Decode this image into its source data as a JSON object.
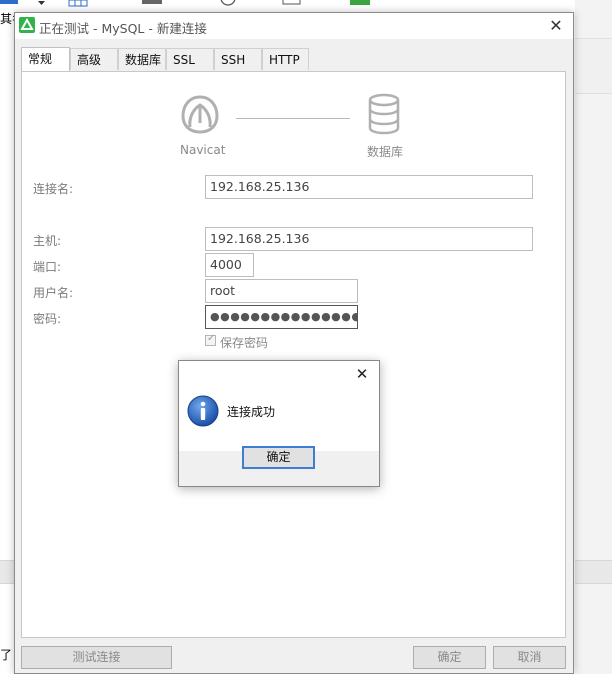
{
  "background": {
    "left_top_text": "其名",
    "left_bottom_text": "了"
  },
  "window": {
    "title": "正在测试 - MySQL - 新建连接",
    "close_glyph": "✕"
  },
  "tabs": [
    {
      "label": "常规",
      "active": true
    },
    {
      "label": "高级"
    },
    {
      "label": "数据库"
    },
    {
      "label": "SSL"
    },
    {
      "label": "SSH"
    },
    {
      "label": "HTTP"
    }
  ],
  "diagram": {
    "left_label": "Navicat",
    "right_label": "数据库"
  },
  "form": {
    "connection_name_label": "连接名:",
    "connection_name_value": "192.168.25.136",
    "host_label": "主机:",
    "host_value": "192.168.25.136",
    "port_label": "端口:",
    "port_value": "4000",
    "username_label": "用户名:",
    "username_value": "root",
    "password_label": "密码:",
    "password_value": "●●●●●●●●●●●●●●●●●●",
    "save_password_label": "保存密码",
    "save_password_checked": true
  },
  "buttons": {
    "test_connection": "测试连接",
    "ok": "确定",
    "cancel": "取消"
  },
  "dialog": {
    "message": "连接成功",
    "ok": "确定",
    "close_glyph": "✕"
  },
  "colors": {
    "accent": "#3c7fd0",
    "navicat_green": "#2fb34a"
  }
}
